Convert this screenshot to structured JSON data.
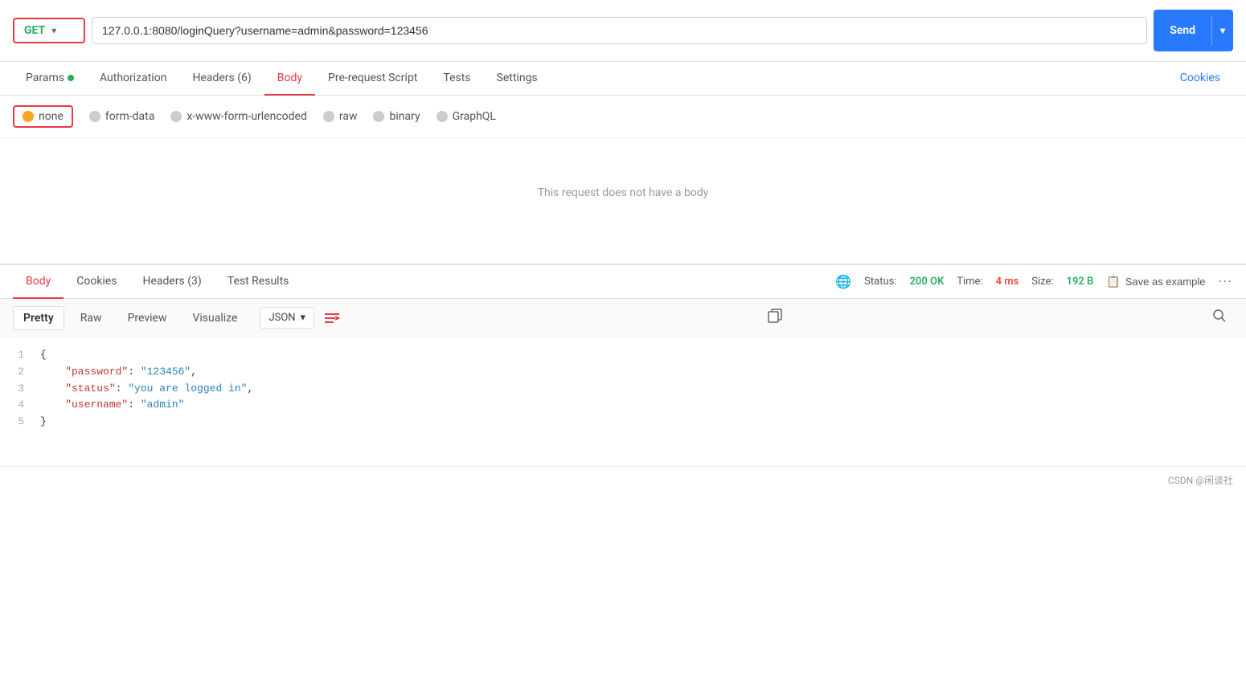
{
  "urlBar": {
    "method": "GET",
    "url": "127.0.0.1:8080/loginQuery?username=admin&password=123456",
    "sendLabel": "Send"
  },
  "requestTabs": [
    {
      "id": "params",
      "label": "Params",
      "hasDot": true,
      "active": false
    },
    {
      "id": "authorization",
      "label": "Authorization",
      "active": false
    },
    {
      "id": "headers",
      "label": "Headers (6)",
      "active": false
    },
    {
      "id": "body",
      "label": "Body",
      "active": true
    },
    {
      "id": "prerequest",
      "label": "Pre-request Script",
      "active": false
    },
    {
      "id": "tests",
      "label": "Tests",
      "active": false
    },
    {
      "id": "settings",
      "label": "Settings",
      "active": false
    },
    {
      "id": "cookies",
      "label": "Cookies",
      "active": false
    }
  ],
  "bodyTypes": [
    {
      "id": "none",
      "label": "none",
      "selected": true
    },
    {
      "id": "form-data",
      "label": "form-data",
      "selected": false
    },
    {
      "id": "x-www-form-urlencoded",
      "label": "x-www-form-urlencoded",
      "selected": false
    },
    {
      "id": "raw",
      "label": "raw",
      "selected": false
    },
    {
      "id": "binary",
      "label": "binary",
      "selected": false
    },
    {
      "id": "graphql",
      "label": "GraphQL",
      "selected": false
    }
  ],
  "bodyEmptyText": "This request does not have a body",
  "responseTabs": [
    {
      "id": "body",
      "label": "Body",
      "active": true
    },
    {
      "id": "cookies",
      "label": "Cookies",
      "active": false
    },
    {
      "id": "headers",
      "label": "Headers (3)",
      "active": false
    },
    {
      "id": "testresults",
      "label": "Test Results",
      "active": false
    }
  ],
  "responseMeta": {
    "statusLabel": "Status:",
    "statusCode": "200 OK",
    "timeLabel": "Time:",
    "timeValue": "4 ms",
    "sizeLabel": "Size:",
    "sizeValue": "192 B"
  },
  "saveExampleLabel": "Save as example",
  "moreLabel": "···",
  "formatTabs": [
    {
      "id": "pretty",
      "label": "Pretty",
      "active": true
    },
    {
      "id": "raw",
      "label": "Raw",
      "active": false
    },
    {
      "id": "preview",
      "label": "Preview",
      "active": false
    },
    {
      "id": "visualize",
      "label": "Visualize",
      "active": false
    }
  ],
  "jsonFormat": "JSON",
  "responseCode": [
    {
      "lineNum": "1",
      "content": "{"
    },
    {
      "lineNum": "2",
      "content": "    \"password\": \"123456\","
    },
    {
      "lineNum": "3",
      "content": "    \"status\": \"you are logged in\","
    },
    {
      "lineNum": "4",
      "content": "    \"username\": \"admin\""
    },
    {
      "lineNum": "5",
      "content": "}"
    }
  ],
  "footerBrand": "CSDN @闲谈社"
}
